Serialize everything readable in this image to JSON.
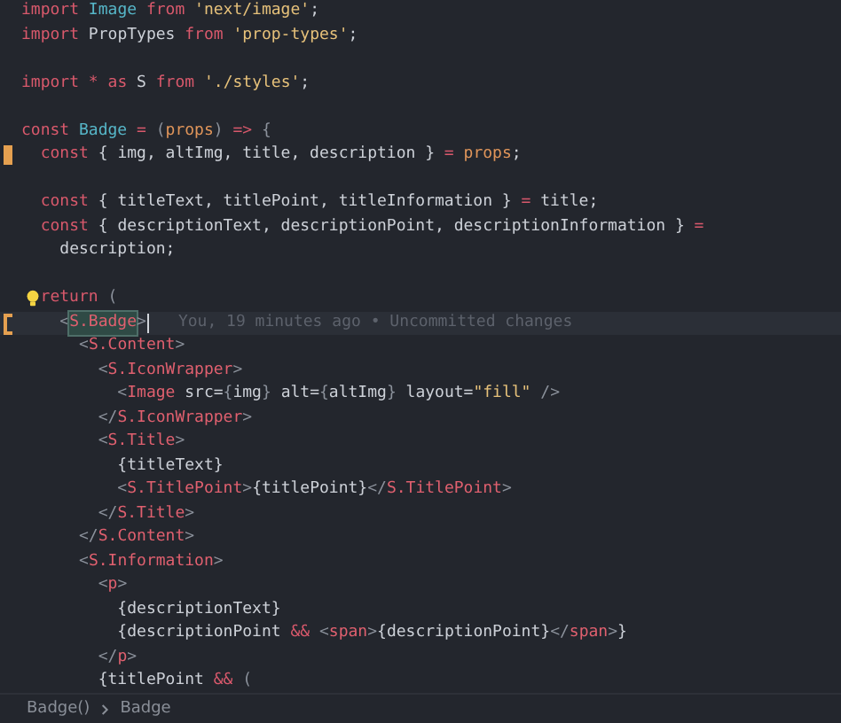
{
  "editor": {
    "lines": [
      {
        "changed": false,
        "active": false,
        "hint": false,
        "tokens": [
          {
            "kind": "kw",
            "text": "import"
          },
          {
            "kind": "type",
            "text": " Image"
          },
          {
            "kind": "kw",
            "text": " from"
          },
          {
            "kind": "str",
            "text": " 'next/image'"
          },
          {
            "kind": "plain",
            "text": ";"
          }
        ]
      },
      {
        "changed": false,
        "active": false,
        "hint": false,
        "tokens": [
          {
            "kind": "kw",
            "text": "import"
          },
          {
            "kind": "plain",
            "text": " PropTypes"
          },
          {
            "kind": "kw",
            "text": " from"
          },
          {
            "kind": "str",
            "text": " 'prop-types'"
          },
          {
            "kind": "plain",
            "text": ";"
          }
        ]
      },
      {
        "changed": false,
        "active": false,
        "hint": false
      },
      {
        "changed": false,
        "active": false,
        "hint": false,
        "tokens": [
          {
            "kind": "kw",
            "text": "import"
          },
          {
            "kind": "op",
            "text": " *"
          },
          {
            "kind": "kw",
            "text": " as"
          },
          {
            "kind": "plain",
            "text": " S"
          },
          {
            "kind": "kw",
            "text": " from"
          },
          {
            "kind": "str",
            "text": " './styles'"
          },
          {
            "kind": "plain",
            "text": ";"
          }
        ]
      },
      {
        "changed": false,
        "active": false,
        "hint": false
      },
      {
        "changed": false,
        "active": false,
        "hint": false,
        "tokens": [
          {
            "kind": "kw",
            "text": "const"
          },
          {
            "kind": "type",
            "text": " Badge"
          },
          {
            "kind": "op",
            "text": " ="
          },
          {
            "kind": "punct",
            "text": " ("
          },
          {
            "kind": "param",
            "text": "props"
          },
          {
            "kind": "punct",
            "text": ")"
          },
          {
            "kind": "op",
            "text": " =>"
          },
          {
            "kind": "punct",
            "text": " {"
          }
        ]
      },
      {
        "changed": true,
        "active": false,
        "hint": false,
        "tokens": [
          {
            "kind": "kw",
            "text": "  const"
          },
          {
            "kind": "plain",
            "text": " { img, altImg, title, description }"
          },
          {
            "kind": "op",
            "text": " ="
          },
          {
            "kind": "param",
            "text": " props"
          },
          {
            "kind": "plain",
            "text": ";"
          }
        ]
      },
      {
        "changed": false,
        "active": false,
        "hint": false
      },
      {
        "changed": false,
        "active": false,
        "hint": false,
        "tokens": [
          {
            "kind": "kw",
            "text": "  const"
          },
          {
            "kind": "plain",
            "text": " { titleText, titlePoint, titleInformation }"
          },
          {
            "kind": "op",
            "text": " ="
          },
          {
            "kind": "plain",
            "text": " title;"
          }
        ]
      },
      {
        "changed": false,
        "active": false,
        "hint": false,
        "tokens": [
          {
            "kind": "kw",
            "text": "  const"
          },
          {
            "kind": "plain",
            "text": " { descriptionText, descriptionPoint, descriptionInformation }"
          },
          {
            "kind": "op",
            "text": " ="
          }
        ]
      },
      {
        "changed": false,
        "active": false,
        "hint": false,
        "tokens": [
          {
            "kind": "plain",
            "text": "    description;"
          }
        ]
      },
      {
        "changed": false,
        "active": false,
        "hint": false
      },
      {
        "changed": false,
        "active": false,
        "hint": true,
        "tokens": [
          {
            "kind": "kw",
            "text": "return"
          },
          {
            "kind": "punct",
            "text": " ("
          }
        ]
      },
      {
        "changed": true,
        "active": true,
        "hint": false,
        "blame": "You, 19 minutes ago • Uncommitted changes",
        "tokens": [
          {
            "kind": "punct",
            "text": "    <"
          },
          {
            "kind": "match",
            "text": "S.Badge"
          },
          {
            "kind": "punct",
            "text": ">"
          }
        ]
      },
      {
        "changed": false,
        "active": false,
        "hint": false,
        "tokens": [
          {
            "kind": "punct",
            "text": "      <"
          },
          {
            "kind": "tag",
            "text": "S.Content"
          },
          {
            "kind": "punct",
            "text": ">"
          }
        ]
      },
      {
        "changed": false,
        "active": false,
        "hint": false,
        "tokens": [
          {
            "kind": "punct",
            "text": "        <"
          },
          {
            "kind": "tag",
            "text": "S.IconWrapper"
          },
          {
            "kind": "punct",
            "text": ">"
          }
        ]
      },
      {
        "changed": false,
        "active": false,
        "hint": false,
        "tokens": [
          {
            "kind": "punct",
            "text": "          <"
          },
          {
            "kind": "tag",
            "text": "Image"
          },
          {
            "kind": "plain",
            "text": " src="
          },
          {
            "kind": "punct",
            "text": "{"
          },
          {
            "kind": "plain",
            "text": "img"
          },
          {
            "kind": "punct",
            "text": "}"
          },
          {
            "kind": "plain",
            "text": " alt="
          },
          {
            "kind": "punct",
            "text": "{"
          },
          {
            "kind": "plain",
            "text": "altImg"
          },
          {
            "kind": "punct",
            "text": "}"
          },
          {
            "kind": "plain",
            "text": " layout="
          },
          {
            "kind": "str",
            "text": "\"fill\""
          },
          {
            "kind": "punct",
            "text": " />"
          }
        ]
      },
      {
        "changed": false,
        "active": false,
        "hint": false,
        "tokens": [
          {
            "kind": "punct",
            "text": "        </"
          },
          {
            "kind": "tag",
            "text": "S.IconWrapper"
          },
          {
            "kind": "punct",
            "text": ">"
          }
        ]
      },
      {
        "changed": false,
        "active": false,
        "hint": false,
        "tokens": [
          {
            "kind": "punct",
            "text": "        <"
          },
          {
            "kind": "tag",
            "text": "S.Title"
          },
          {
            "kind": "punct",
            "text": ">"
          }
        ]
      },
      {
        "changed": false,
        "active": false,
        "hint": false,
        "tokens": [
          {
            "kind": "plain",
            "text": "          {titleText}"
          }
        ]
      },
      {
        "changed": false,
        "active": false,
        "hint": false,
        "tokens": [
          {
            "kind": "punct",
            "text": "          <"
          },
          {
            "kind": "tag",
            "text": "S.TitlePoint"
          },
          {
            "kind": "punct",
            "text": ">"
          },
          {
            "kind": "plain",
            "text": "{titlePoint}"
          },
          {
            "kind": "punct",
            "text": "</"
          },
          {
            "kind": "tag",
            "text": "S.TitlePoint"
          },
          {
            "kind": "punct",
            "text": ">"
          }
        ]
      },
      {
        "changed": false,
        "active": false,
        "hint": false,
        "tokens": [
          {
            "kind": "punct",
            "text": "        </"
          },
          {
            "kind": "tag",
            "text": "S.Title"
          },
          {
            "kind": "punct",
            "text": ">"
          }
        ]
      },
      {
        "changed": false,
        "active": false,
        "hint": false,
        "tokens": [
          {
            "kind": "punct",
            "text": "      </"
          },
          {
            "kind": "tag",
            "text": "S.Content"
          },
          {
            "kind": "punct",
            "text": ">"
          }
        ]
      },
      {
        "changed": false,
        "active": false,
        "hint": false,
        "tokens": [
          {
            "kind": "punct",
            "text": "      <"
          },
          {
            "kind": "tag",
            "text": "S.Information"
          },
          {
            "kind": "punct",
            "text": ">"
          }
        ]
      },
      {
        "changed": false,
        "active": false,
        "hint": false,
        "tokens": [
          {
            "kind": "punct",
            "text": "        <"
          },
          {
            "kind": "tag",
            "text": "p"
          },
          {
            "kind": "punct",
            "text": ">"
          }
        ]
      },
      {
        "changed": false,
        "active": false,
        "hint": false,
        "tokens": [
          {
            "kind": "plain",
            "text": "          {descriptionText}"
          }
        ]
      },
      {
        "changed": false,
        "active": false,
        "hint": false,
        "tokens": [
          {
            "kind": "plain",
            "text": "          {descriptionPoint"
          },
          {
            "kind": "op",
            "text": " &&"
          },
          {
            "kind": "punct",
            "text": " <"
          },
          {
            "kind": "tag",
            "text": "span"
          },
          {
            "kind": "punct",
            "text": ">"
          },
          {
            "kind": "plain",
            "text": "{descriptionPoint}"
          },
          {
            "kind": "punct",
            "text": "</"
          },
          {
            "kind": "tag",
            "text": "span"
          },
          {
            "kind": "punct",
            "text": ">"
          },
          {
            "kind": "plain",
            "text": "}"
          }
        ]
      },
      {
        "changed": false,
        "active": false,
        "hint": false,
        "tokens": [
          {
            "kind": "punct",
            "text": "        </"
          },
          {
            "kind": "tag",
            "text": "p"
          },
          {
            "kind": "punct",
            "text": ">"
          }
        ]
      },
      {
        "changed": false,
        "active": false,
        "hint": false,
        "tokens": [
          {
            "kind": "plain",
            "text": "        {titlePoint"
          },
          {
            "kind": "op",
            "text": " &&"
          },
          {
            "kind": "punct",
            "text": " ("
          }
        ]
      }
    ]
  },
  "breadcrumbs": [
    "Badge()",
    "Badge"
  ]
}
